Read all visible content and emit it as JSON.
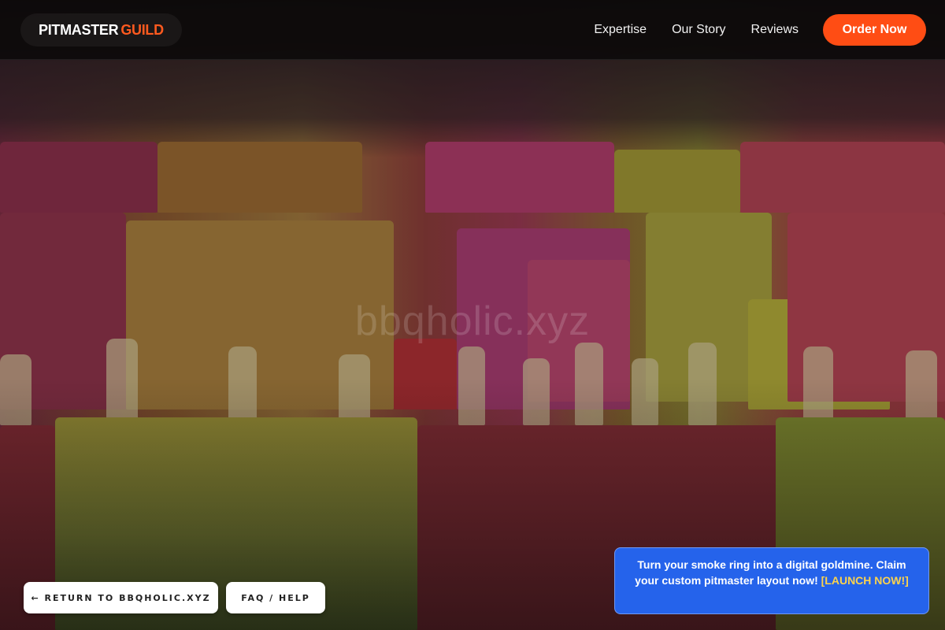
{
  "nav": {
    "brand_primary": "PITMASTER",
    "brand_accent": "GUILD",
    "links": [
      "Expertise",
      "Our Story",
      "Reviews"
    ],
    "order_label": "Order Now"
  },
  "hero": {
    "watermark": "bbqholic.xyz",
    "image_subject": "rows of colorful popsicles"
  },
  "footer": {
    "return_label": "← RETURN TO BBQHOLIC.XYZ",
    "faq_label": "FAQ / HELP"
  },
  "promo": {
    "text": "Turn your smoke ring into a digital goldmine. Claim your custom pitmaster layout now!",
    "cta": "[LAUNCH NOW!]"
  },
  "colors": {
    "accent": "#ff4d14",
    "promo_bg": "#2563eb",
    "promo_cta": "#fcd34d"
  }
}
